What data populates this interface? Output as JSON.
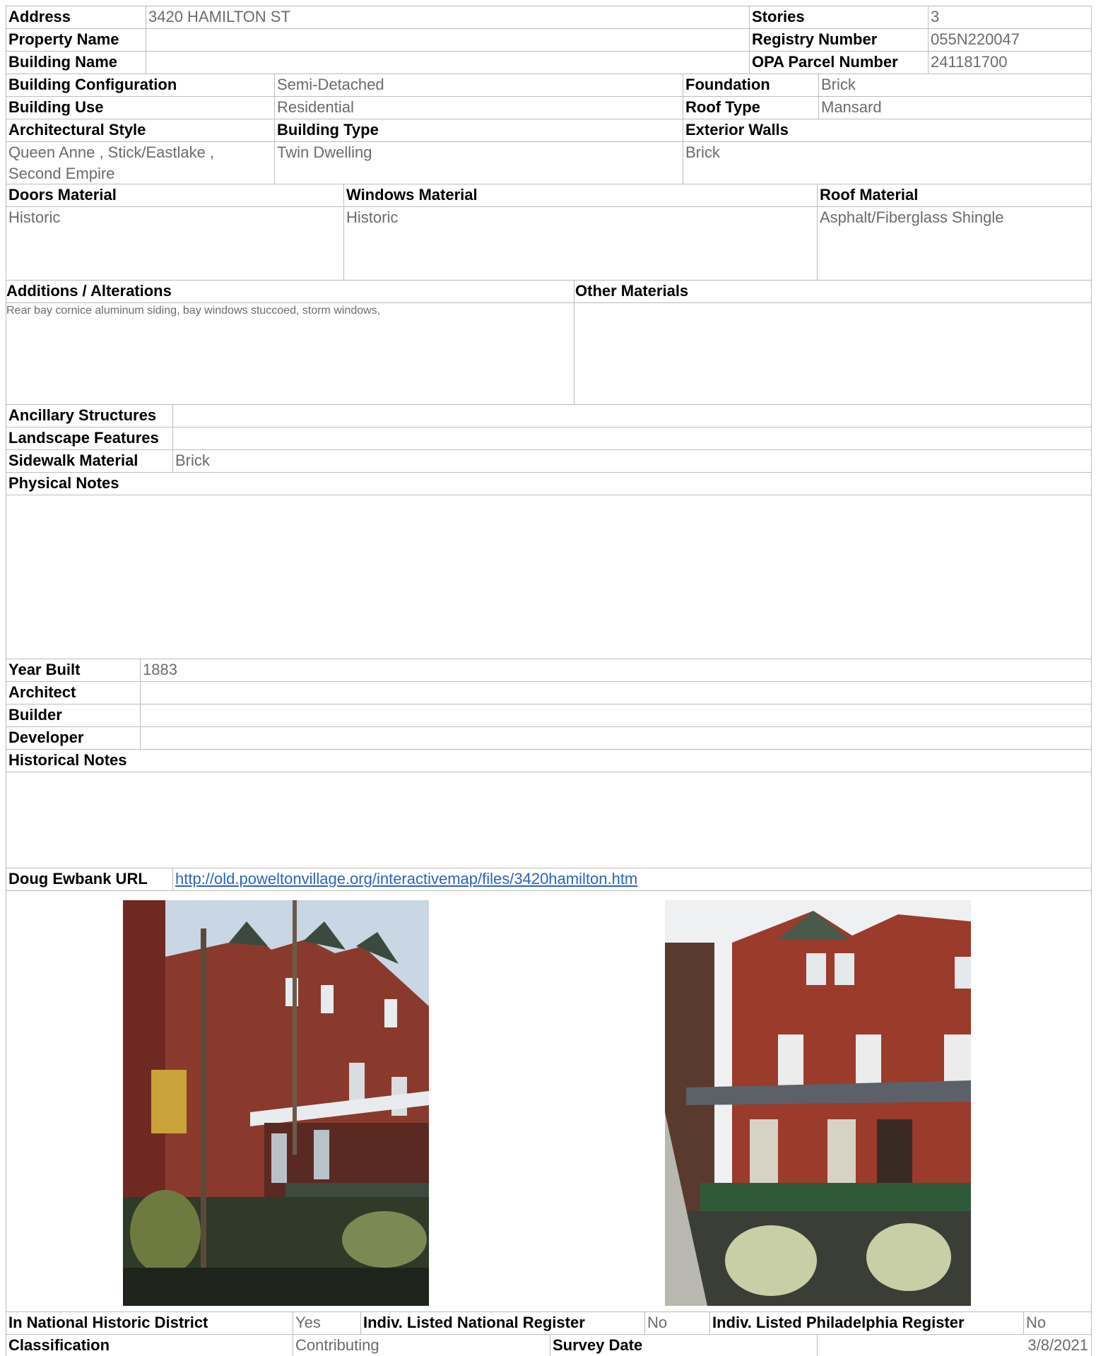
{
  "address": {
    "label": "Address",
    "value": "3420 HAMILTON ST"
  },
  "stories": {
    "label": "Stories",
    "value": "3"
  },
  "property_name": {
    "label": "Property Name",
    "value": ""
  },
  "registry_number": {
    "label": "Registry Number",
    "value": "055N220047"
  },
  "building_name": {
    "label": "Building Name",
    "value": ""
  },
  "opa_parcel": {
    "label": "OPA Parcel Number",
    "value": "241181700"
  },
  "building_configuration": {
    "label": "Building Configuration",
    "value": "Semi-Detached"
  },
  "foundation": {
    "label": "Foundation",
    "value": "Brick"
  },
  "building_use": {
    "label": "Building Use",
    "value": "Residential"
  },
  "roof_type": {
    "label": "Roof Type",
    "value": "Mansard"
  },
  "architectural_style": {
    "label": "Architectural Style",
    "value_line1": "Queen Anne , Stick/Eastlake ,",
    "value_line2": "Second Empire"
  },
  "building_type": {
    "label": "Building Type",
    "value": "Twin Dwelling"
  },
  "exterior_walls": {
    "label": "Exterior Walls",
    "value": "Brick"
  },
  "doors_material": {
    "label": "Doors Material",
    "value": "Historic"
  },
  "windows_material": {
    "label": "Windows Material",
    "value": "Historic"
  },
  "roof_material": {
    "label": "Roof Material",
    "value": "Asphalt/Fiberglass Shingle"
  },
  "additions": {
    "label": "Additions / Alterations",
    "value": "Rear bay cornice aluminum siding, bay windows stuccoed, storm windows,"
  },
  "other_materials": {
    "label": "Other Materials",
    "value": ""
  },
  "ancillary_structures": {
    "label": "Ancillary Structures",
    "value": ""
  },
  "landscape_features": {
    "label": "Landscape Features",
    "value": ""
  },
  "sidewalk_material": {
    "label": "Sidewalk Material",
    "value": "Brick"
  },
  "physical_notes": {
    "label": "Physical Notes",
    "value": ""
  },
  "year_built": {
    "label": "Year Built",
    "value": "1883"
  },
  "architect": {
    "label": "Architect",
    "value": ""
  },
  "builder": {
    "label": "Builder",
    "value": ""
  },
  "developer": {
    "label": "Developer",
    "value": ""
  },
  "historical_notes": {
    "label": "Historical Notes",
    "value": ""
  },
  "doug_ewbank_url": {
    "label": "Doug Ewbank URL",
    "value": "http://old.poweltonvillage.org/interactivemap/files/3420hamilton.htm"
  },
  "national_district": {
    "label": "In National Historic District",
    "value": "Yes"
  },
  "indiv_national": {
    "label": "Indiv. Listed National Register",
    "value": "No"
  },
  "indiv_philadelphia": {
    "label": "Indiv. Listed Philadelphia Register",
    "value": "No"
  },
  "classification": {
    "label": "Classification",
    "value": "Contributing"
  },
  "survey_date": {
    "label": "Survey Date",
    "value": "3/8/2021"
  }
}
